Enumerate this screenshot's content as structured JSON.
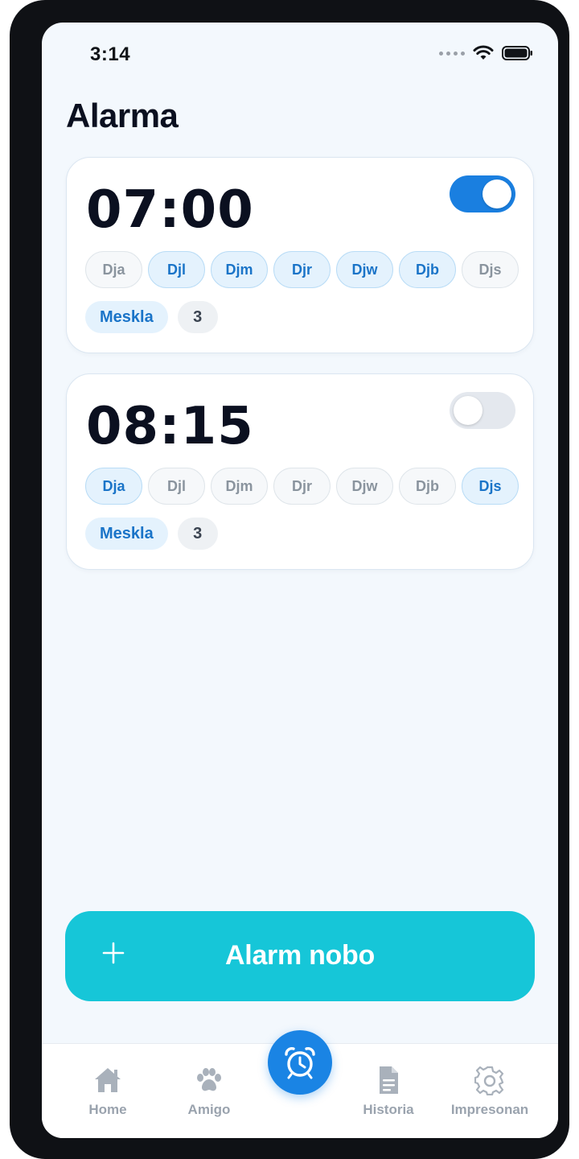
{
  "status_bar": {
    "time": "3:14"
  },
  "page": {
    "title": "Alarma"
  },
  "alarms": [
    {
      "time": "07:00",
      "enabled": true,
      "days": [
        {
          "label": "Dja",
          "active": false
        },
        {
          "label": "Djl",
          "active": true
        },
        {
          "label": "Djm",
          "active": true
        },
        {
          "label": "Djr",
          "active": true
        },
        {
          "label": "Djw",
          "active": true
        },
        {
          "label": "Djb",
          "active": true
        },
        {
          "label": "Djs",
          "active": false
        }
      ],
      "sound": "Meskla",
      "count": "3"
    },
    {
      "time": "08:15",
      "enabled": false,
      "days": [
        {
          "label": "Dja",
          "active": true
        },
        {
          "label": "Djl",
          "active": false
        },
        {
          "label": "Djm",
          "active": false
        },
        {
          "label": "Djr",
          "active": false
        },
        {
          "label": "Djw",
          "active": false
        },
        {
          "label": "Djb",
          "active": false
        },
        {
          "label": "Djs",
          "active": true
        }
      ],
      "sound": "Meskla",
      "count": "3"
    }
  ],
  "new_alarm": {
    "label": "Alarm nobo",
    "icon": "plus-icon"
  },
  "nav": {
    "items": [
      {
        "label": "Home",
        "icon": "home-icon"
      },
      {
        "label": "Amigo",
        "icon": "paw-icon"
      },
      {
        "label": "Historia",
        "icon": "document-icon"
      },
      {
        "label": "Impresonan",
        "icon": "gear-icon"
      }
    ],
    "center_icon": "alarm-clock-icon"
  },
  "colors": {
    "accent": "#1a84e4",
    "toggle_on": "#1a7fe0",
    "button": "#16c6d8",
    "background": "#f3f8fd"
  }
}
